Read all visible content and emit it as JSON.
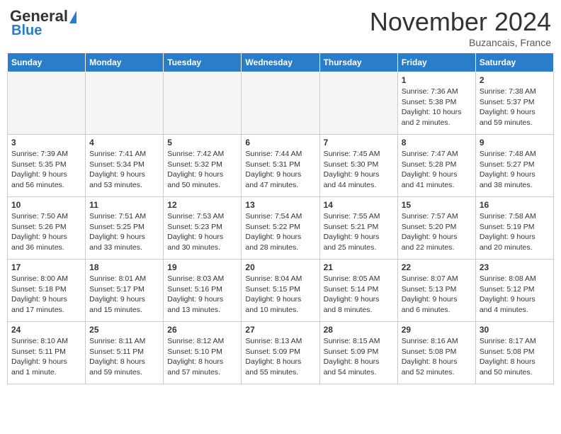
{
  "header": {
    "logo_general": "General",
    "logo_blue": "Blue",
    "month_title": "November 2024",
    "subtitle": "Buzancais, France"
  },
  "days_of_week": [
    "Sunday",
    "Monday",
    "Tuesday",
    "Wednesday",
    "Thursday",
    "Friday",
    "Saturday"
  ],
  "weeks": [
    [
      {
        "day": "",
        "info": ""
      },
      {
        "day": "",
        "info": ""
      },
      {
        "day": "",
        "info": ""
      },
      {
        "day": "",
        "info": ""
      },
      {
        "day": "",
        "info": ""
      },
      {
        "day": "1",
        "info": "Sunrise: 7:36 AM\nSunset: 5:38 PM\nDaylight: 10 hours\nand 2 minutes."
      },
      {
        "day": "2",
        "info": "Sunrise: 7:38 AM\nSunset: 5:37 PM\nDaylight: 9 hours\nand 59 minutes."
      }
    ],
    [
      {
        "day": "3",
        "info": "Sunrise: 7:39 AM\nSunset: 5:35 PM\nDaylight: 9 hours\nand 56 minutes."
      },
      {
        "day": "4",
        "info": "Sunrise: 7:41 AM\nSunset: 5:34 PM\nDaylight: 9 hours\nand 53 minutes."
      },
      {
        "day": "5",
        "info": "Sunrise: 7:42 AM\nSunset: 5:32 PM\nDaylight: 9 hours\nand 50 minutes."
      },
      {
        "day": "6",
        "info": "Sunrise: 7:44 AM\nSunset: 5:31 PM\nDaylight: 9 hours\nand 47 minutes."
      },
      {
        "day": "7",
        "info": "Sunrise: 7:45 AM\nSunset: 5:30 PM\nDaylight: 9 hours\nand 44 minutes."
      },
      {
        "day": "8",
        "info": "Sunrise: 7:47 AM\nSunset: 5:28 PM\nDaylight: 9 hours\nand 41 minutes."
      },
      {
        "day": "9",
        "info": "Sunrise: 7:48 AM\nSunset: 5:27 PM\nDaylight: 9 hours\nand 38 minutes."
      }
    ],
    [
      {
        "day": "10",
        "info": "Sunrise: 7:50 AM\nSunset: 5:26 PM\nDaylight: 9 hours\nand 36 minutes."
      },
      {
        "day": "11",
        "info": "Sunrise: 7:51 AM\nSunset: 5:25 PM\nDaylight: 9 hours\nand 33 minutes."
      },
      {
        "day": "12",
        "info": "Sunrise: 7:53 AM\nSunset: 5:23 PM\nDaylight: 9 hours\nand 30 minutes."
      },
      {
        "day": "13",
        "info": "Sunrise: 7:54 AM\nSunset: 5:22 PM\nDaylight: 9 hours\nand 28 minutes."
      },
      {
        "day": "14",
        "info": "Sunrise: 7:55 AM\nSunset: 5:21 PM\nDaylight: 9 hours\nand 25 minutes."
      },
      {
        "day": "15",
        "info": "Sunrise: 7:57 AM\nSunset: 5:20 PM\nDaylight: 9 hours\nand 22 minutes."
      },
      {
        "day": "16",
        "info": "Sunrise: 7:58 AM\nSunset: 5:19 PM\nDaylight: 9 hours\nand 20 minutes."
      }
    ],
    [
      {
        "day": "17",
        "info": "Sunrise: 8:00 AM\nSunset: 5:18 PM\nDaylight: 9 hours\nand 17 minutes."
      },
      {
        "day": "18",
        "info": "Sunrise: 8:01 AM\nSunset: 5:17 PM\nDaylight: 9 hours\nand 15 minutes."
      },
      {
        "day": "19",
        "info": "Sunrise: 8:03 AM\nSunset: 5:16 PM\nDaylight: 9 hours\nand 13 minutes."
      },
      {
        "day": "20",
        "info": "Sunrise: 8:04 AM\nSunset: 5:15 PM\nDaylight: 9 hours\nand 10 minutes."
      },
      {
        "day": "21",
        "info": "Sunrise: 8:05 AM\nSunset: 5:14 PM\nDaylight: 9 hours\nand 8 minutes."
      },
      {
        "day": "22",
        "info": "Sunrise: 8:07 AM\nSunset: 5:13 PM\nDaylight: 9 hours\nand 6 minutes."
      },
      {
        "day": "23",
        "info": "Sunrise: 8:08 AM\nSunset: 5:12 PM\nDaylight: 9 hours\nand 4 minutes."
      }
    ],
    [
      {
        "day": "24",
        "info": "Sunrise: 8:10 AM\nSunset: 5:11 PM\nDaylight: 9 hours\nand 1 minute."
      },
      {
        "day": "25",
        "info": "Sunrise: 8:11 AM\nSunset: 5:11 PM\nDaylight: 8 hours\nand 59 minutes."
      },
      {
        "day": "26",
        "info": "Sunrise: 8:12 AM\nSunset: 5:10 PM\nDaylight: 8 hours\nand 57 minutes."
      },
      {
        "day": "27",
        "info": "Sunrise: 8:13 AM\nSunset: 5:09 PM\nDaylight: 8 hours\nand 55 minutes."
      },
      {
        "day": "28",
        "info": "Sunrise: 8:15 AM\nSunset: 5:09 PM\nDaylight: 8 hours\nand 54 minutes."
      },
      {
        "day": "29",
        "info": "Sunrise: 8:16 AM\nSunset: 5:08 PM\nDaylight: 8 hours\nand 52 minutes."
      },
      {
        "day": "30",
        "info": "Sunrise: 8:17 AM\nSunset: 5:08 PM\nDaylight: 8 hours\nand 50 minutes."
      }
    ]
  ]
}
